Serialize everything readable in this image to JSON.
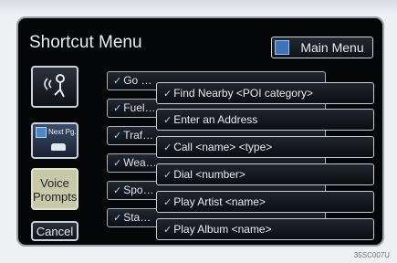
{
  "header": {
    "title": "Shortcut Menu",
    "main_menu_label": "Main Menu"
  },
  "left_buttons": {
    "next_label": "Next Pg.",
    "voice_line1": "Voice",
    "voice_line2": "Prompts",
    "cancel_label": "Cancel"
  },
  "back_list": [
    "Go …",
    "Fuel…",
    "Traf…",
    "Wea…",
    "Spo…",
    "Sta…"
  ],
  "front_list": [
    "Find Nearby <POI category>",
    "Enter an Address",
    "Call <name> <type>",
    "Dial <number>",
    "Play Artist <name>",
    "Play Album <name>"
  ],
  "check_glyph": "✓",
  "code": "35SC007U",
  "colors": {
    "screen_bg": "#050608",
    "accent": "#3d74b8",
    "voice_btn": "#c8c9a8"
  }
}
